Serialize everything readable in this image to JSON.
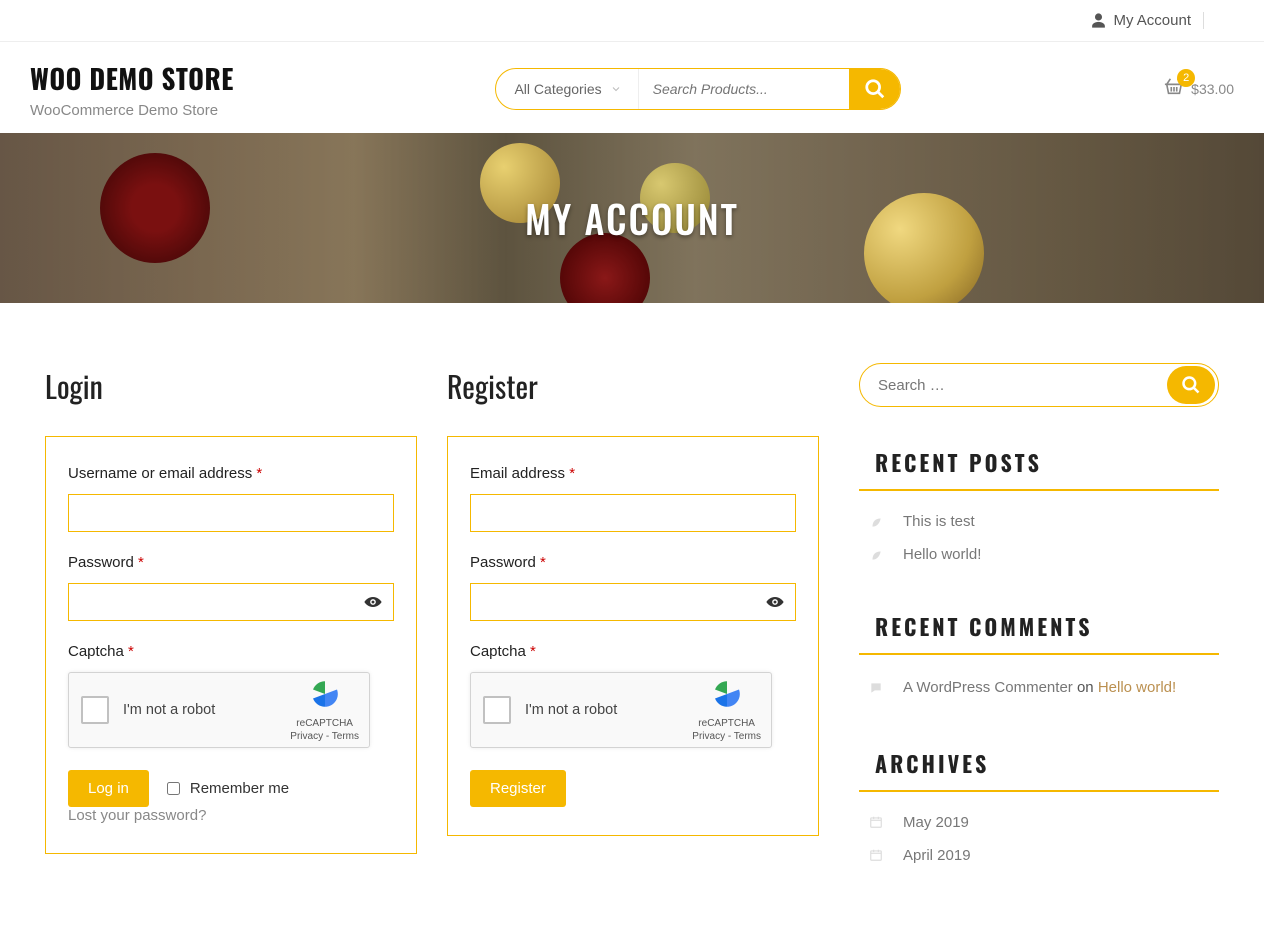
{
  "topbar": {
    "account_label": "My Account"
  },
  "header": {
    "site_title": "WOO DEMO STORE",
    "site_subtitle": "WooCommerce Demo Store",
    "categories_label": "All Categories",
    "search_placeholder": "Search Products...",
    "cart": {
      "count": "2",
      "total": "$33.00"
    }
  },
  "hero": {
    "title": "MY ACCOUNT"
  },
  "login": {
    "heading": "Login",
    "username_label": "Username or email address ",
    "password_label": "Password ",
    "captcha_label": "Captcha ",
    "recaptcha_text": "I'm not a robot",
    "recaptcha_brand": "reCAPTCHA",
    "recaptcha_terms": "Privacy - Terms",
    "submit": "Log in",
    "remember": "Remember me",
    "lost_password": "Lost your password?"
  },
  "register": {
    "heading": "Register",
    "email_label": "Email address ",
    "password_label": "Password ",
    "captcha_label": "Captcha ",
    "recaptcha_text": "I'm not a robot",
    "recaptcha_brand": "reCAPTCHA",
    "recaptcha_terms": "Privacy - Terms",
    "submit": "Register"
  },
  "sidebar": {
    "search_placeholder": "Search …",
    "recent_posts_title": "RECENT POSTS",
    "recent_posts": [
      "This is test",
      "Hello world!"
    ],
    "recent_comments_title": "RECENT COMMENTS",
    "recent_comment_author": "A WordPress Commenter",
    "recent_comment_on": " on ",
    "recent_comment_post": "Hello world!",
    "archives_title": "ARCHIVES",
    "archives": [
      "May 2019",
      "April 2019"
    ]
  },
  "colors": {
    "accent": "#F5B800",
    "required": "#c00"
  }
}
